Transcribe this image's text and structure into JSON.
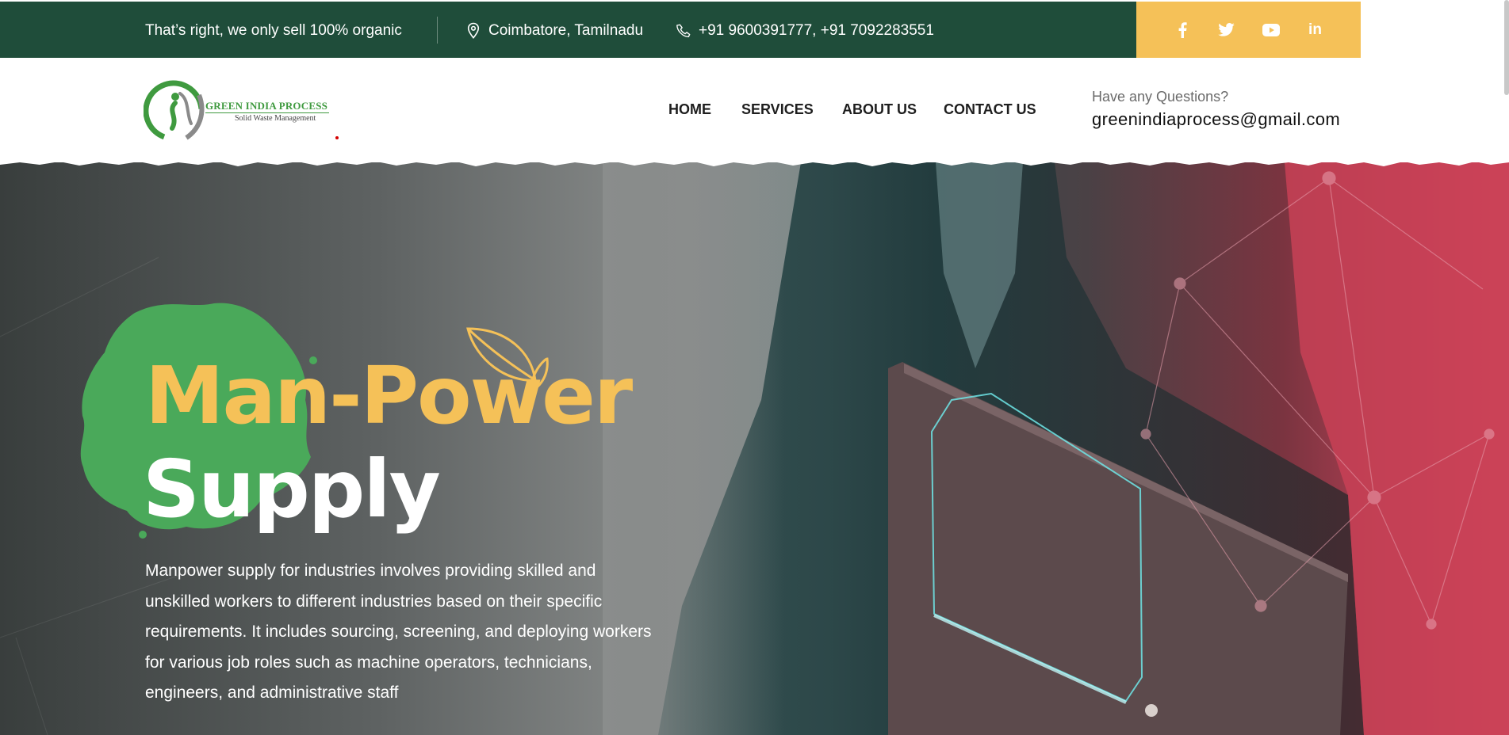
{
  "topbar": {
    "tagline": "That’s right, we only sell 100% organic",
    "location": "Coimbatore, Tamilnadu",
    "phone": "+91 9600391777, +91 7092283551",
    "bg_color": "#1f4d3a",
    "social_bg_color": "#f5c158",
    "social": [
      {
        "name": "facebook-icon"
      },
      {
        "name": "twitter-icon"
      },
      {
        "name": "youtube-icon"
      },
      {
        "name": "linkedin-icon",
        "label": "in"
      }
    ]
  },
  "header": {
    "logo_title": "GREEN INDIA PROCESS",
    "logo_subtitle": "Solid Waste Management",
    "nav": [
      {
        "label": "HOME"
      },
      {
        "label": "SERVICES"
      },
      {
        "label": "ABOUT US"
      },
      {
        "label": "CONTACT US"
      }
    ],
    "questions_label": "Have any Questions?",
    "email": "greenindiaprocess@gmail.com"
  },
  "hero": {
    "headline_line1": "Man-Power",
    "headline_line2": "Supply",
    "accent_color": "#f5c158",
    "splash_color": "#4aa95a",
    "description": "Manpower supply for industries involves providing skilled and unskilled workers to different industries based on their specific requirements. It includes sourcing, screening, and deploying workers for various job roles such as machine operators, technicians, engineers, and administrative staff"
  }
}
